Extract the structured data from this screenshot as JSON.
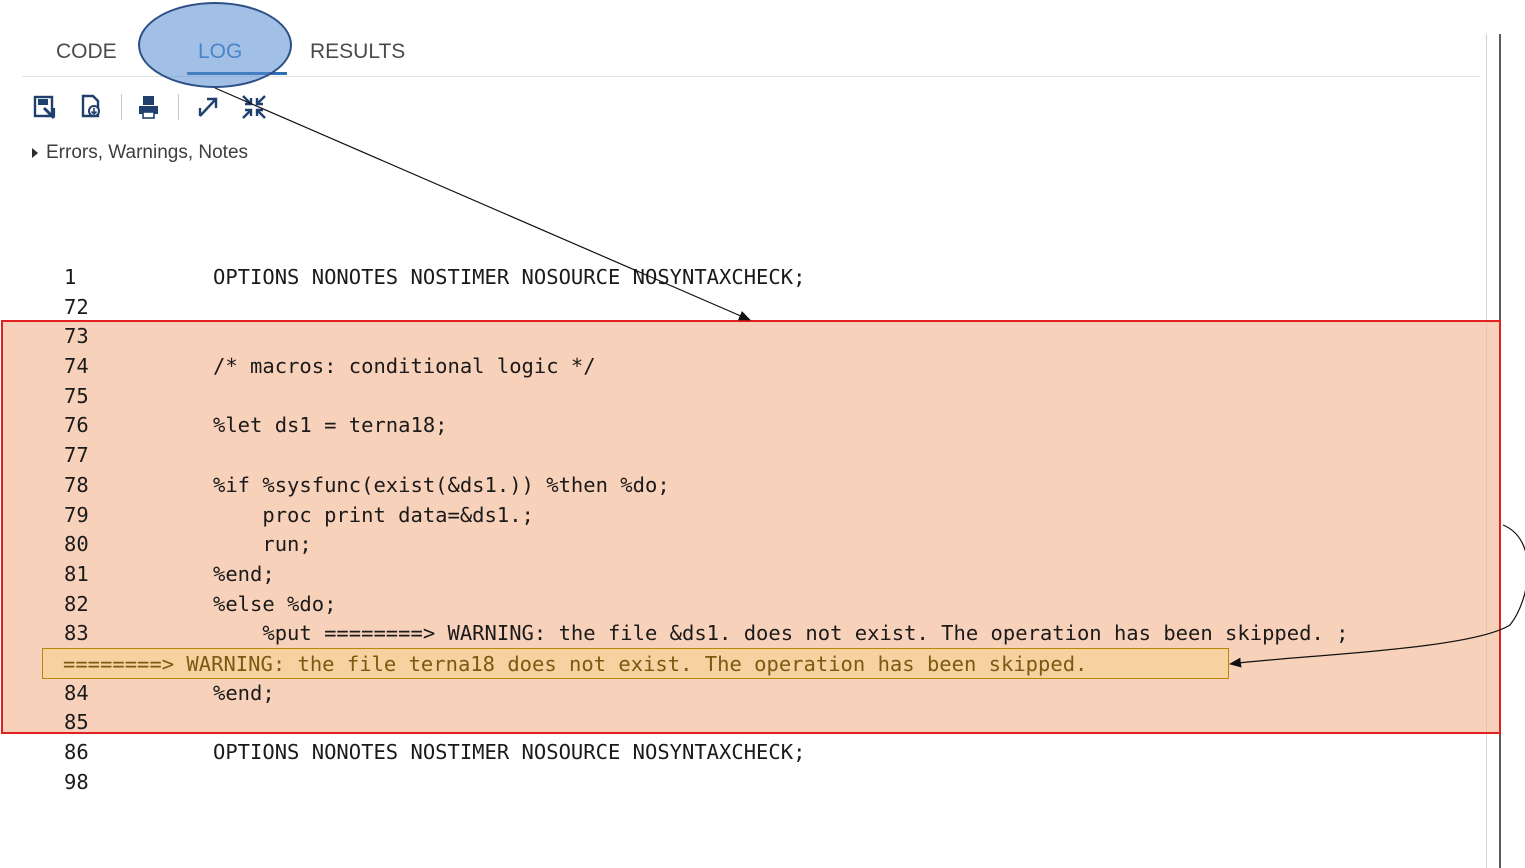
{
  "tabs": [
    {
      "label": "CODE"
    },
    {
      "label": "LOG",
      "active": true
    },
    {
      "label": "RESULTS"
    }
  ],
  "toolbar": {
    "icons": [
      "save-log-icon",
      "download-log-icon",
      "print-icon",
      "expand-icon",
      "collapse-icon"
    ]
  },
  "filter": {
    "label": "Errors, Warnings, Notes"
  },
  "log_lines": [
    {
      "num": "1",
      "code": "OPTIONS NONOTES NOSTIMER NOSOURCE NOSYNTAXCHECK;"
    },
    {
      "num": "72",
      "code": ""
    },
    {
      "num": "73",
      "code": ""
    },
    {
      "num": "74",
      "code": "/* macros: conditional logic */"
    },
    {
      "num": "75",
      "code": ""
    },
    {
      "num": "76",
      "code": "%let ds1 = terna18;"
    },
    {
      "num": "77",
      "code": ""
    },
    {
      "num": "78",
      "code": "%if %sysfunc(exist(&ds1.)) %then %do;"
    },
    {
      "num": "79",
      "code": "    proc print data=&ds1.;"
    },
    {
      "num": "80",
      "code": "    run;"
    },
    {
      "num": "81",
      "code": "%end;"
    },
    {
      "num": "82",
      "code": "%else %do;"
    },
    {
      "num": "83",
      "code": "    %put ========> WARNING: the file &ds1. does not exist. The operation has been skipped. ;"
    },
    {
      "num": "84",
      "code": "%end;"
    },
    {
      "num": "85",
      "code": ""
    },
    {
      "num": "86",
      "code": "OPTIONS NONOTES NOSTIMER NOSOURCE NOSYNTAXCHECK;"
    },
    {
      "num": "98",
      "code": ""
    }
  ],
  "warning_output": "========> WARNING: the file terna18 does not exist. The operation has been skipped.",
  "colors": {
    "active_tab": "#3a7dc1",
    "highlight_fill": "#f6c2a3",
    "highlight_border": "#e12020",
    "warning_fill": "#f6d2a0",
    "warning_text": "#7a5a10"
  }
}
